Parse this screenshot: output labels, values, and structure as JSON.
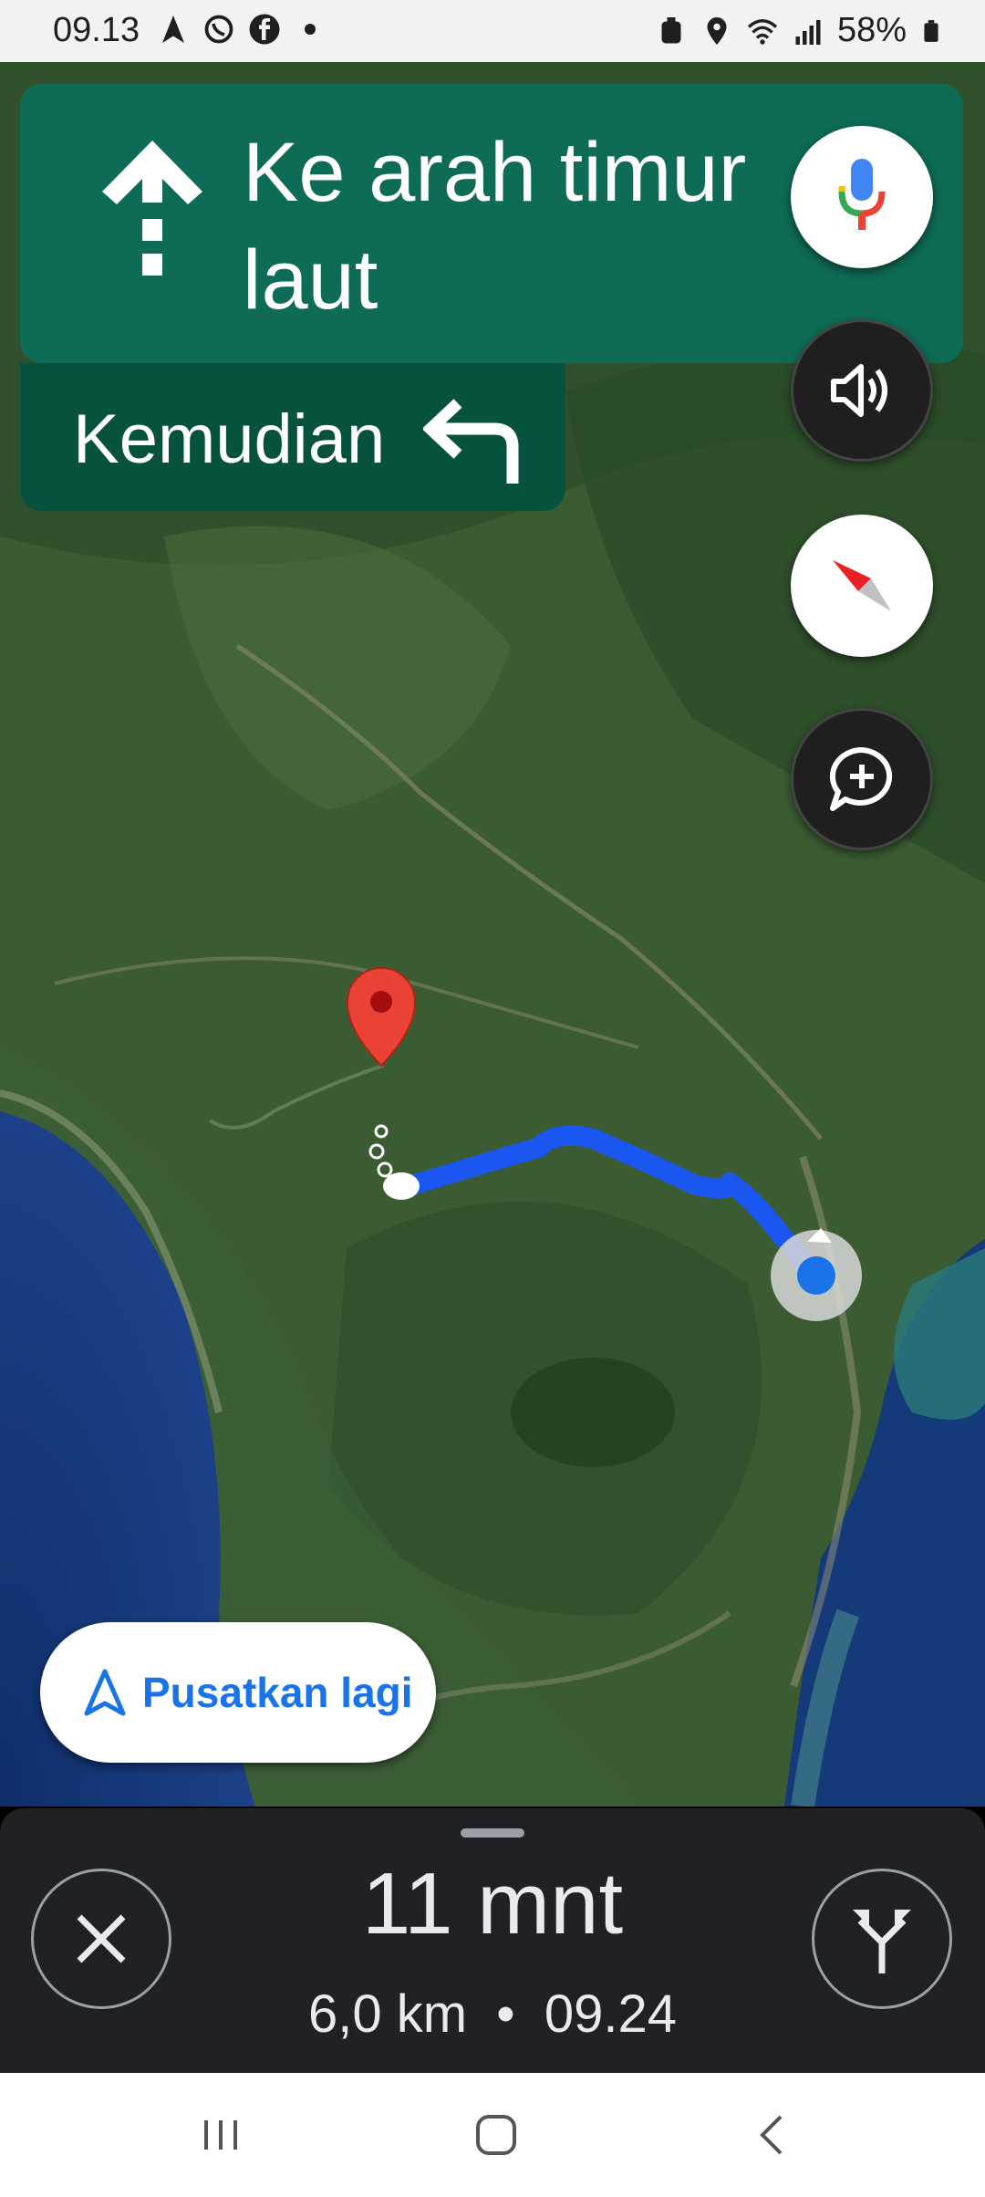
{
  "status_bar": {
    "time": "09.13",
    "battery": "58%",
    "left_icons": [
      "navigation-arrow-icon",
      "whatsapp-icon",
      "facebook-icon",
      "dot-icon"
    ],
    "right_icons": [
      "recycle-icon",
      "location-icon",
      "wifi-icon",
      "signal-icon",
      "battery-icon"
    ]
  },
  "navigation": {
    "instruction": "Ke arah timur laut",
    "maneuver_icon": "straight-arrow-icon",
    "then_label": "Kemudian",
    "then_icon": "turn-left-icon"
  },
  "map_controls": [
    {
      "name": "voice-search-button",
      "icon": "microphone-icon"
    },
    {
      "name": "sound-button",
      "icon": "speaker-icon"
    },
    {
      "name": "compass-button",
      "icon": "compass-icon"
    },
    {
      "name": "report-button",
      "icon": "add-comment-icon"
    }
  ],
  "recenter": {
    "label": "Pusatkan lagi",
    "icon": "navigation-arrow-icon"
  },
  "trip": {
    "duration": "11 mnt",
    "distance": "6,0 km",
    "separator": "•",
    "arrival": "09.24"
  },
  "colors": {
    "nav_green": "#0e6b55",
    "nav_dark_green": "#07513f",
    "route_blue": "#1a57f0",
    "accent_blue": "#1a73e8",
    "panel_bg": "#202124",
    "pin_red": "#ea4335"
  }
}
